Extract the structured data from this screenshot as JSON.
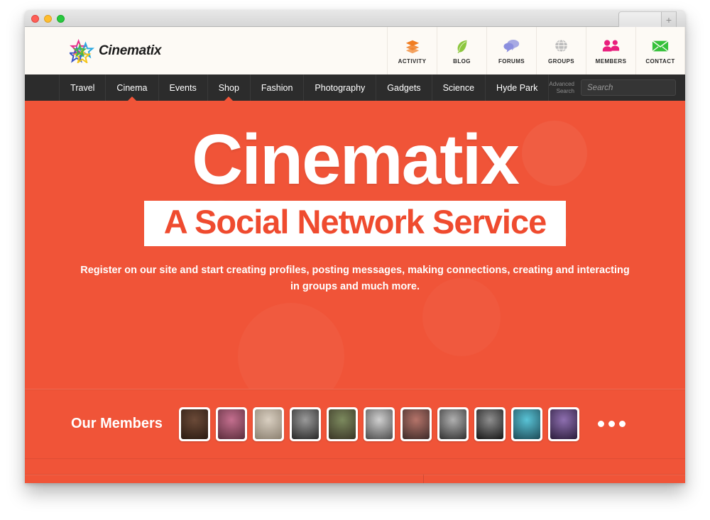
{
  "window": {
    "controls": [
      "close",
      "minimize",
      "maximize"
    ],
    "new_tab_label": "+"
  },
  "site": {
    "logo_text": "Cinematix"
  },
  "header_nav": [
    {
      "label": "ACTIVITY",
      "icon": "layers-icon",
      "color": "#f07d22"
    },
    {
      "label": "BLOG",
      "icon": "leaf-icon",
      "color": "#8cc63e"
    },
    {
      "label": "FORUMS",
      "icon": "speech-bubbles-icon",
      "color": "#9b9ee0"
    },
    {
      "label": "GROUPS",
      "icon": "globe-icon",
      "color": "#b8b8b8"
    },
    {
      "label": "MEMBERS",
      "icon": "people-icon",
      "color": "#e91e7c"
    },
    {
      "label": "CONTACT",
      "icon": "envelope-icon",
      "color": "#35c13a"
    }
  ],
  "main_nav": {
    "items": [
      {
        "label": "Travel",
        "has_dropdown": false
      },
      {
        "label": "Cinema",
        "has_dropdown": true
      },
      {
        "label": "Events",
        "has_dropdown": false
      },
      {
        "label": "Shop",
        "has_dropdown": true
      },
      {
        "label": "Fashion",
        "has_dropdown": false
      },
      {
        "label": "Photography",
        "has_dropdown": false
      },
      {
        "label": "Gadgets",
        "has_dropdown": false
      },
      {
        "label": "Science",
        "has_dropdown": false
      },
      {
        "label": "Hyde Park",
        "has_dropdown": false
      }
    ],
    "advanced_search_line1": "Advanced",
    "advanced_search_line2": "Search",
    "search_placeholder": "Search",
    "search_value": "",
    "search_icon": "magnifier-icon"
  },
  "hero": {
    "title": "Cinematix",
    "subtitle": "A Social Network Service",
    "description": "Register on our site and start creating profiles, posting messages, making connections, creating and interacting in groups and much more.",
    "slider_dots": [
      {
        "state": "active"
      },
      {
        "state": "idle"
      },
      {
        "state": "idle"
      }
    ],
    "cta_icons": [
      "running-man-icon",
      "arrow-right-icon"
    ],
    "background_color": "#f05438"
  },
  "members": {
    "title": "Our Members",
    "avatars": [
      {
        "name": "member-avatar-1",
        "c1": "#6b4a38",
        "c2": "#2b1b12"
      },
      {
        "name": "member-avatar-2",
        "c1": "#c46f8f",
        "c2": "#5b2d3c"
      },
      {
        "name": "member-avatar-3",
        "c1": "#d9cfc1",
        "c2": "#8b8070"
      },
      {
        "name": "member-avatar-4",
        "c1": "#9a9a9a",
        "c2": "#272727"
      },
      {
        "name": "member-avatar-5",
        "c1": "#7c8a5e",
        "c2": "#3a3526"
      },
      {
        "name": "member-avatar-6",
        "c1": "#d0d0d0",
        "c2": "#4c4c4c"
      },
      {
        "name": "member-avatar-7",
        "c1": "#b5746a",
        "c2": "#3d2a28"
      },
      {
        "name": "member-avatar-8",
        "c1": "#b0b0b0",
        "c2": "#303030"
      },
      {
        "name": "member-avatar-9",
        "c1": "#8f8f8f",
        "c2": "#151515"
      },
      {
        "name": "member-avatar-10",
        "c1": "#59c3d6",
        "c2": "#1d4a56"
      },
      {
        "name": "member-avatar-11",
        "c1": "#8e6fb0",
        "c2": "#2a1c3a"
      }
    ],
    "more_label": "more-members"
  }
}
